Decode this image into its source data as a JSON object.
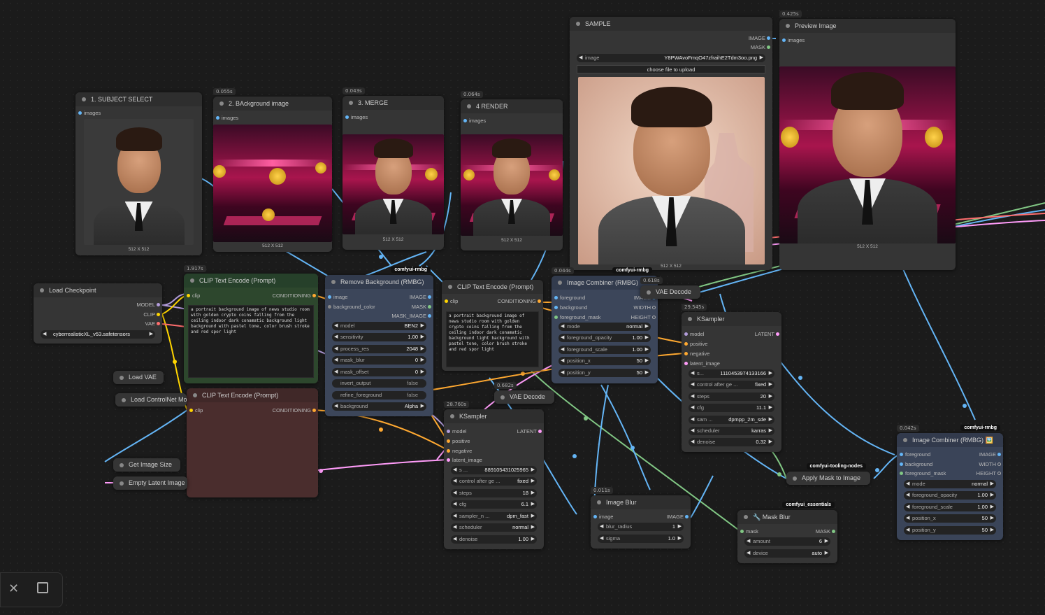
{
  "nodes": {
    "subject_select": {
      "title": "1. SUBJECT SELECT",
      "output": "images",
      "caption": "512 X 512"
    },
    "background_image": {
      "title": "2. BAckground image",
      "timing": "0.055s",
      "output": "images",
      "caption": "512 X 512"
    },
    "merge": {
      "title": "3. MERGE",
      "timing": "0.043s",
      "output": "images",
      "caption": "512 X 512"
    },
    "render": {
      "title": "4 RENDER",
      "timing": "0.064s",
      "output": "images",
      "caption": "512 X 512"
    },
    "sample": {
      "title": "SAMPLE",
      "out_image": "IMAGE",
      "out_mask": "MASK",
      "image_label": "image",
      "image_value": "Y8PWAvoFmqO47zfraihE2Tdm3oo.png",
      "upload_label": "choose file to upload",
      "caption": "512 X 512"
    },
    "preview": {
      "title": "Preview Image",
      "timing": "0.425s",
      "input": "images",
      "caption": "512 X 512"
    },
    "load_checkpoint": {
      "title": "Load Checkpoint",
      "outputs": [
        "MODEL",
        "CLIP",
        "VAE"
      ],
      "ckpt": "cyberrealisticXL_v53.safetensors"
    },
    "clip_pos": {
      "title": "CLIP Text Encode (Prompt)",
      "timing": "1.917s",
      "input": "clip",
      "output": "CONDITIONING",
      "text": "a portrait background image of news studio room with golden crypto coins falling from the ceiling indoor dark conamatic background light background with pastel tone, color brush stroke and red spor light"
    },
    "clip_neg": {
      "title": "CLIP Text Encode (Prompt)",
      "input": "clip",
      "output": "CONDITIONING"
    },
    "load_vae": {
      "title": "Load VAE"
    },
    "load_controlnet": {
      "title": "Load ControlNet Mo"
    },
    "get_image_size": {
      "title": "Get Image Size"
    },
    "empty_latent": {
      "title": "Empty Latent Image"
    },
    "remove_bg": {
      "title": "Remove Background (RMBG)",
      "badge": "comfyui-rmbg",
      "inputs": [
        "image",
        "background_color"
      ],
      "outputs": [
        "IMAGE",
        "MASK",
        "MASK_IMAGE"
      ],
      "widgets": [
        {
          "label": "model",
          "value": "BEN2"
        },
        {
          "label": "sensitivity",
          "value": "1.00"
        },
        {
          "label": "process_res",
          "value": "2048"
        },
        {
          "label": "mask_blur",
          "value": "0"
        },
        {
          "label": "mask_offset",
          "value": "0"
        },
        {
          "label": "invert_output",
          "value": "false"
        },
        {
          "label": "refine_foreground",
          "value": "false"
        },
        {
          "label": "background",
          "value": "Alpha"
        }
      ]
    },
    "clip_mid": {
      "title": "CLIP Text Encode (Prompt)",
      "input": "clip",
      "output": "CONDITIONING",
      "text": "a portrait background image of news studio room with golden crypto coins falling from the ceiling indoor dark conamatic background light background with pastel tone, color brush stroke and red spor light"
    },
    "image_combiner_1": {
      "title": "Image Combiner (RMBG)",
      "timing": "0.044s",
      "badge": "comfyui-rmbg",
      "inputs": [
        "foreground",
        "background",
        "foreground_mask"
      ],
      "outputs": [
        "IMAGE",
        "WIDTH",
        "HEIGHT"
      ],
      "widgets": [
        {
          "label": "mode",
          "value": "normal"
        },
        {
          "label": "foreground_opacity",
          "value": "1.00"
        },
        {
          "label": "foreground_scale",
          "value": "1.00"
        },
        {
          "label": "position_x",
          "value": "50"
        },
        {
          "label": "position_y",
          "value": "50"
        }
      ]
    },
    "vae_decode_1": {
      "title": "VAE Decode",
      "timing": "0.618s"
    },
    "vae_decode_2": {
      "title": "VAE Decode",
      "timing": "0.682s"
    },
    "ksampler_1": {
      "title": "KSampler",
      "timing": "29.545s",
      "inputs": [
        "model",
        "positive",
        "negative",
        "latent_image"
      ],
      "output": "LATENT",
      "widgets": [
        {
          "label": "s...",
          "value": "1110453974133166"
        },
        {
          "label": "control after ge ...",
          "value": "fixed"
        },
        {
          "label": "steps",
          "value": "20"
        },
        {
          "label": "cfg",
          "value": "11.1"
        },
        {
          "label": "sam ...",
          "value": "dpmpp_2m_sde"
        },
        {
          "label": "scheduler",
          "value": "karras"
        },
        {
          "label": "denoise",
          "value": "0.32"
        }
      ]
    },
    "ksampler_2": {
      "title": "KSampler",
      "timing": "28.760s",
      "inputs": [
        "model",
        "positive",
        "negative",
        "latent_image"
      ],
      "output": "LATENT",
      "widgets": [
        {
          "label": "s ...",
          "value": "889105431025965"
        },
        {
          "label": "control after ge ...",
          "value": "fixed"
        },
        {
          "label": "steps",
          "value": "18"
        },
        {
          "label": "cfg",
          "value": "6.1"
        },
        {
          "label": "sampler_n ...",
          "value": "dpm_fast"
        },
        {
          "label": "scheduler",
          "value": "normal"
        },
        {
          "label": "denoise",
          "value": "1.00"
        }
      ]
    },
    "image_blur": {
      "title": "Image Blur",
      "timing": "0.011s",
      "input": "image",
      "output": "IMAGE",
      "widgets": [
        {
          "label": "blur_radius",
          "value": "1"
        },
        {
          "label": "sigma",
          "value": "1.0"
        }
      ]
    },
    "mask_blur": {
      "title": "Mask Blur",
      "badge": "comfyui_essentials",
      "input": "mask",
      "output": "MASK",
      "widgets": [
        {
          "label": "amount",
          "value": "6"
        },
        {
          "label": "device",
          "value": "auto"
        }
      ]
    },
    "apply_mask": {
      "title": "Apply Mask to Image",
      "badge": "comfyui-tooling-nodes"
    },
    "image_combiner_2": {
      "title": "Image Combiner (RMBG) 🖼️",
      "timing": "0.042s",
      "badge": "comfyui-rmbg",
      "inputs": [
        "foreground",
        "background",
        "foreground_mask"
      ],
      "outputs": [
        "IMAGE",
        "WIDTH",
        "HEIGHT"
      ],
      "widgets": [
        {
          "label": "mode",
          "value": "normal"
        },
        {
          "label": "foreground_opacity",
          "value": "1.00"
        },
        {
          "label": "foreground_scale",
          "value": "1.00"
        },
        {
          "label": "position_x",
          "value": "50"
        },
        {
          "label": "position_y",
          "value": "50"
        }
      ]
    }
  },
  "toolbar": {
    "close_icon": "close-icon",
    "square_icon": "square-icon"
  },
  "colors": {
    "clip": "#ffd500",
    "model": "#b39ddb",
    "vae": "#ff6e6e",
    "image": "#64b5f6",
    "mask": "#81c784",
    "latent": "#ff9cf9",
    "conditioning": "#ffa931"
  }
}
